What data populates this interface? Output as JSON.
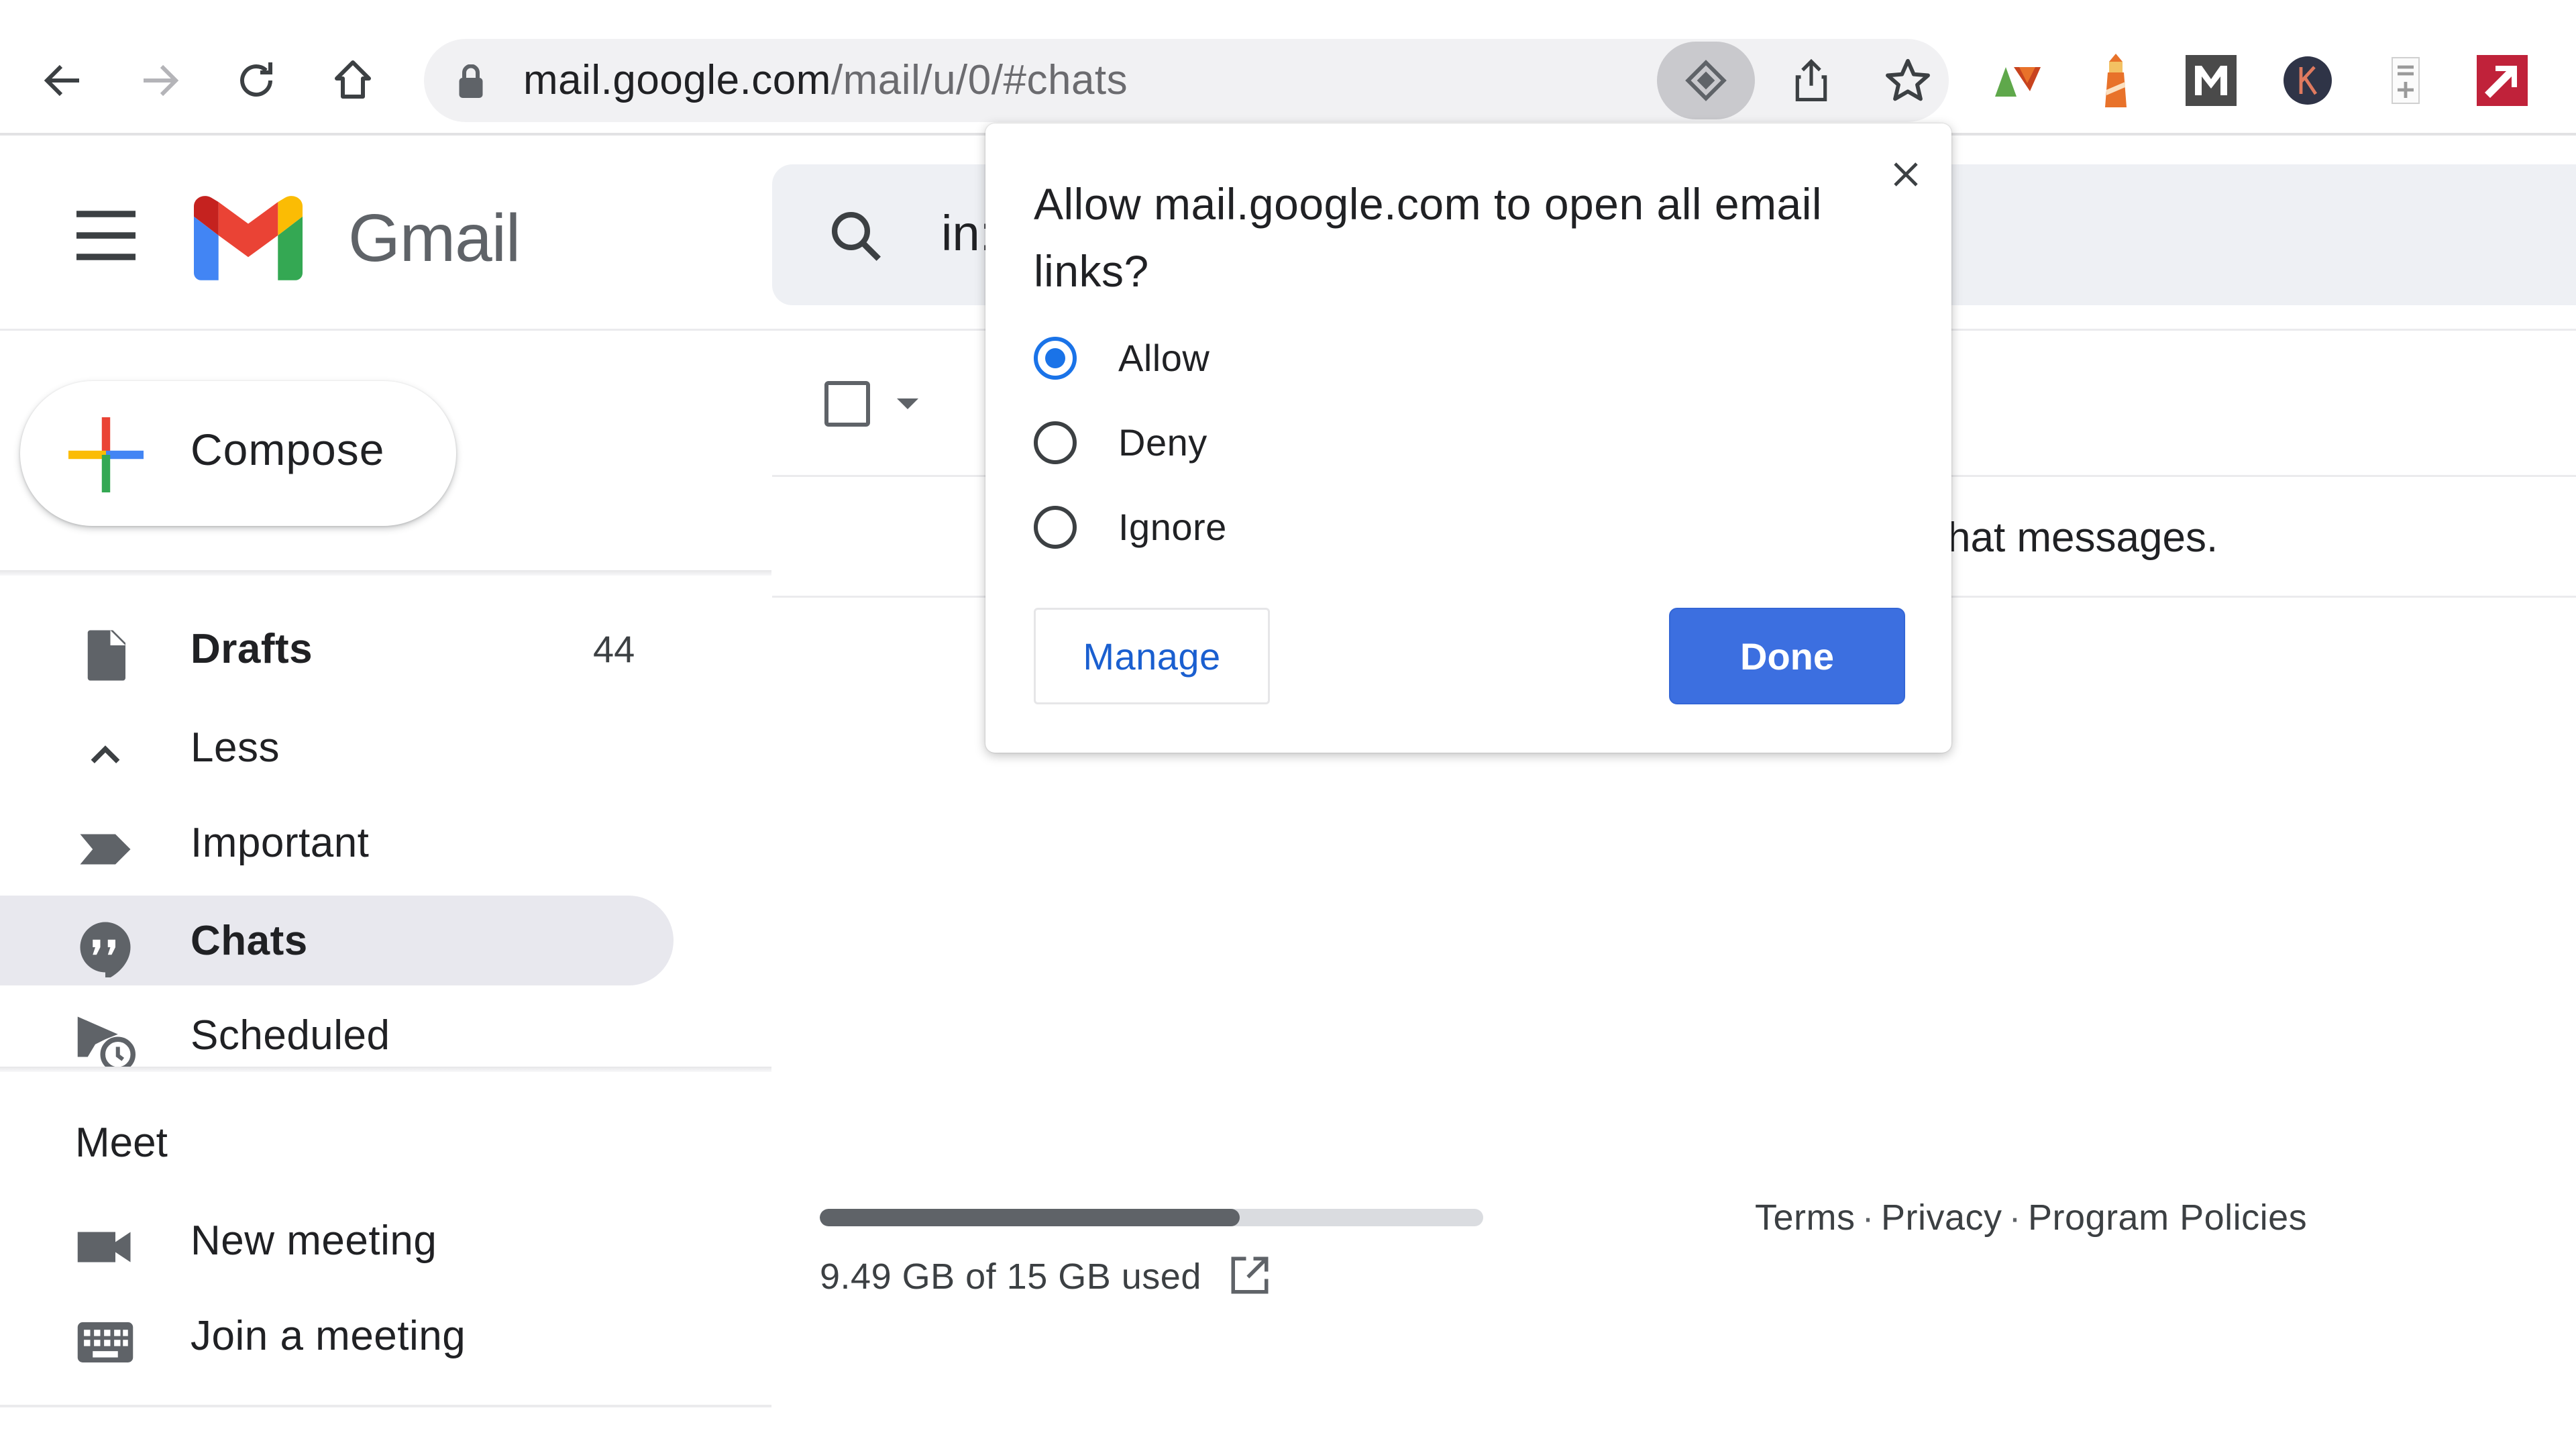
{
  "browser": {
    "url_host": "mail.google.com",
    "url_path": "/mail/u/0/#chats",
    "nav": {
      "back_icon": "arrow-left-icon",
      "forward_icon": "arrow-right-icon",
      "reload_icon": "reload-icon",
      "home_icon": "home-icon"
    },
    "omnibox_actions": [
      "protocol-handler-icon",
      "share-icon",
      "bookmark-star-icon"
    ],
    "extensions": [
      {
        "name": "extension-triangles-icon",
        "colors": [
          "#5fa84b",
          "#c8431e"
        ]
      },
      {
        "name": "extension-lighthouse-icon",
        "colors": [
          "#e8722a"
        ]
      },
      {
        "name": "extension-m-icon",
        "label": "M",
        "colors": [
          "#4a4a4a"
        ]
      },
      {
        "name": "extension-k-icon",
        "label": "K",
        "colors": [
          "#2f3447",
          "#e07a5f"
        ]
      },
      {
        "name": "extension-document-plus-icon",
        "colors": [
          "#9a9a9a"
        ]
      },
      {
        "name": "extension-arrow-icon",
        "colors": [
          "#c0223a"
        ]
      }
    ]
  },
  "gmail": {
    "wordmark": "Gmail",
    "logo_colors": {
      "red": "#ea4335",
      "blue": "#4285f4",
      "green": "#34a853",
      "yellow": "#fbbc04",
      "dark_red": "#c5221f"
    },
    "search_text": "in:",
    "compose_label": "Compose",
    "sidebar": {
      "items": [
        {
          "label": "Drafts",
          "count": "44",
          "icon": "draft-icon",
          "bold": true
        },
        {
          "label": "Less",
          "icon": "chevron-up-icon"
        },
        {
          "label": "Important",
          "icon": "important-marker-icon"
        },
        {
          "label": "Chats",
          "icon": "chat-bubble-icon",
          "active": true,
          "bold": true
        },
        {
          "label": "Scheduled",
          "icon": "scheduled-send-icon"
        }
      ],
      "meet_heading": "Meet",
      "meet_items": [
        {
          "label": "New meeting",
          "icon": "video-camera-icon"
        },
        {
          "label": "Join a meeting",
          "icon": "keyboard-icon"
        }
      ]
    },
    "main": {
      "empty_message_visible": "hat messages.",
      "storage": {
        "used_text": "9.49 GB of 15 GB used",
        "used_fraction": 0.633
      },
      "footer_links": [
        "Terms",
        "Privacy",
        "Program Policies"
      ],
      "footer_separator": "·"
    }
  },
  "dialog": {
    "title": "Allow mail.google.com to open all email links?",
    "options": [
      {
        "label": "Allow",
        "checked": true
      },
      {
        "label": "Deny",
        "checked": false
      },
      {
        "label": "Ignore",
        "checked": false
      }
    ],
    "manage_label": "Manage",
    "done_label": "Done",
    "accent_color": "#1a73e8",
    "done_color": "#3c6fe0"
  }
}
